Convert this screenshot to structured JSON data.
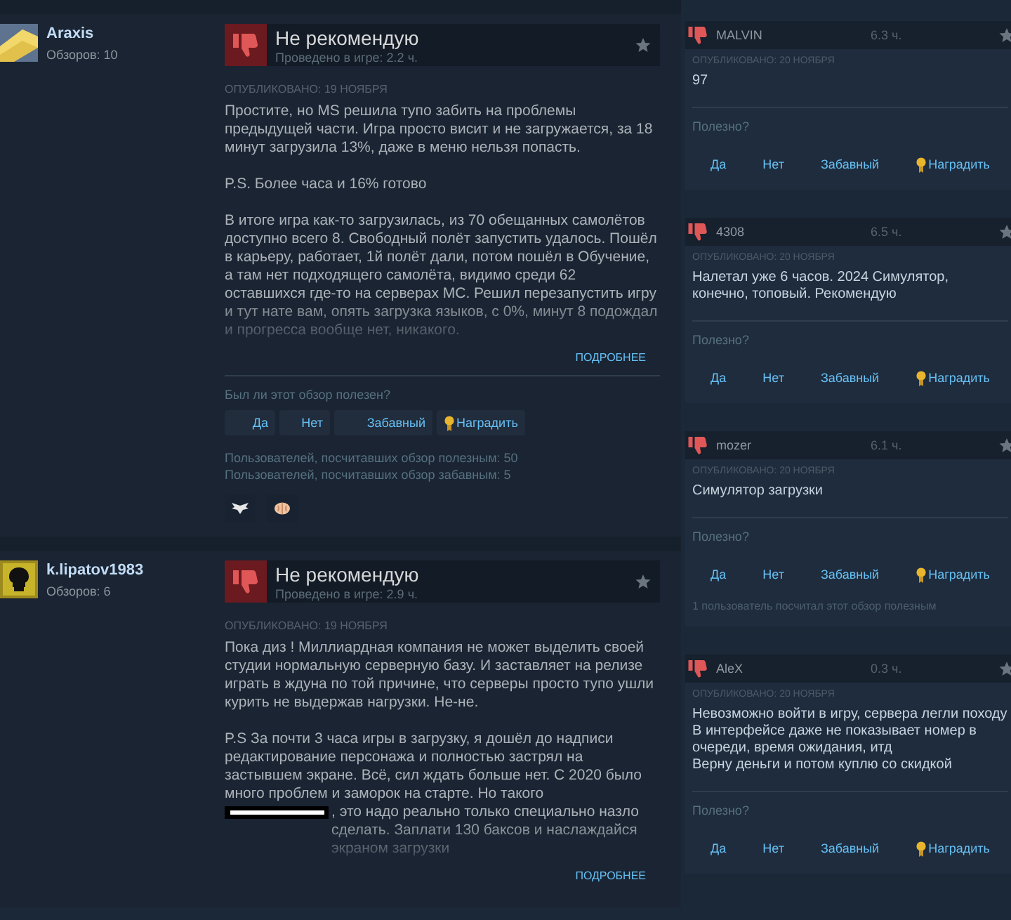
{
  "reviews": [
    {
      "author": {
        "name": "Araxis",
        "reviews_count": "Обзоров: 10",
        "avatar": {
          "kind": "block"
        }
      },
      "recommended": false,
      "verdict": "Не рекомендую",
      "playtime": "Проведено в игре: 2.2 ч.",
      "posted": "ОПУБЛИКОВАНО: 19 НОЯБРЯ",
      "truncated": true,
      "paragraphs": [
        {
          "kind": "text",
          "text": "Простите, но MS решила тупо забить на проблемы предыдущей части. Игра просто висит и не загружается, за 18 минут загрузила 13%, даже в меню нельзя попасть."
        },
        {
          "kind": "text",
          "text": "P.S. Более часа и 16% готово"
        },
        {
          "kind": "text",
          "text": "В итоге игра как-то загрузилась, из 70 обещанных самолётов доступно всего 8. Свободный полёт запустить удалось. Пошёл в карьеру, работает, 1й полёт дали, потом пошёл в Обучение, а там нет подходящего самолёта, видимо среди 62 оставшихся где-то на серверах МС. Решил перезапустить игру и тут нате вам, опять загрузка языков, с 0%, минут 8 подождал и прогресса вообще нет, никакого."
        }
      ],
      "read_more": "ПОДРОБНЕЕ",
      "question": "Был ли этот обзор полезен?",
      "buttons": [
        {
          "label": "Да",
          "kind": "plain"
        },
        {
          "label": "Нет",
          "kind": "plain"
        },
        {
          "label": "Забавный",
          "kind": "plain"
        },
        {
          "label": "Наградить",
          "kind": "award"
        }
      ],
      "stats": [
        "Пользователей, посчитавших обзор полезным: 50",
        "Пользователей, посчитавших обзор забавным: 5"
      ],
      "awards": [
        {
          "kind": "wings"
        },
        {
          "kind": "brain"
        }
      ]
    },
    {
      "author": {
        "name": "k.lipatov1983",
        "reviews_count": "Обзоров: 6",
        "avatar": {
          "kind": "skull"
        }
      },
      "recommended": false,
      "verdict": "Не рекомендую",
      "playtime": "Проведено в игре: 2.9 ч.",
      "posted": "ОПУБЛИКОВАНО: 19 НОЯБРЯ",
      "truncated": true,
      "paragraphs": [
        {
          "kind": "text",
          "text": "Пока диз ! Миллиардная компания не может выделить своей студии нормальную серверную базу. И заставляет на релизе играть в ждуна по той причине, что серверы просто тупо ушли курить не выдержав нагрузки. Не-не."
        },
        {
          "kind": "text",
          "text": "P.S За почти 3 часа игры в загрузку, я дошёл до надписи редактирование персонажа и полностью застрял на застывшем экране. Всё, сил ждать больше нет. С 2020 было много проблем и заморок на старте. Но такого"
        },
        {
          "kind": "redacted",
          "text": ", это надо реально только специально назло сделать. Заплати 130 баксов и наслаждайся экраном загрузки"
        }
      ],
      "read_more": "ПОДРОБНЕЕ"
    }
  ],
  "side_reviews": [
    {
      "name": "MALVIN",
      "recommended": false,
      "hours": "6.3 ч.",
      "posted": "ОПУБЛИКОВАНО: 20 НОЯБРЯ",
      "text": "97",
      "question": "Полезно?",
      "buttons": [
        {
          "label": "Да",
          "kind": "plain"
        },
        {
          "label": "Нет",
          "kind": "plain"
        },
        {
          "label": "Забавный",
          "kind": "plain"
        },
        {
          "label": "Наградить",
          "kind": "award"
        }
      ]
    },
    {
      "name": "4308",
      "recommended": false,
      "hours": "6.5 ч.",
      "posted": "ОПУБЛИКОВАНО: 20 НОЯБРЯ",
      "text": "Налетал уже 6 часов. 2024 Симулятор, конечно, топовый. Рекомендую",
      "question": "Полезно?",
      "buttons": [
        {
          "label": "Да",
          "kind": "plain"
        },
        {
          "label": "Нет",
          "kind": "plain"
        },
        {
          "label": "Забавный",
          "kind": "plain"
        },
        {
          "label": "Наградить",
          "kind": "award"
        }
      ]
    },
    {
      "name": "mozer",
      "recommended": false,
      "hours": "6.1 ч.",
      "posted": "ОПУБЛИКОВАНО: 20 НОЯБРЯ",
      "text": "Симулятор загрузки",
      "question": "Полезно?",
      "buttons": [
        {
          "label": "Да",
          "kind": "plain"
        },
        {
          "label": "Нет",
          "kind": "plain"
        },
        {
          "label": "Забавный",
          "kind": "plain"
        },
        {
          "label": "Наградить",
          "kind": "award"
        }
      ],
      "stat": "1 пользователь посчитал этот обзор полезным"
    },
    {
      "name": "AleX",
      "recommended": false,
      "hours": "0.3 ч.",
      "posted": "ОПУБЛИКОВАНО: 20 НОЯБРЯ",
      "text": "Невозможно войти в игру, сервера легли походу\nВ интерфейсе даже не показывает номер в очереди, время ожидания, итд\nВерну деньги и потом куплю со скидкой",
      "question": "Полезно?",
      "buttons": [
        {
          "label": "Да",
          "kind": "plain"
        },
        {
          "label": "Нет",
          "kind": "plain"
        },
        {
          "label": "Забавный",
          "kind": "plain"
        },
        {
          "label": "Наградить",
          "kind": "award"
        }
      ]
    }
  ]
}
